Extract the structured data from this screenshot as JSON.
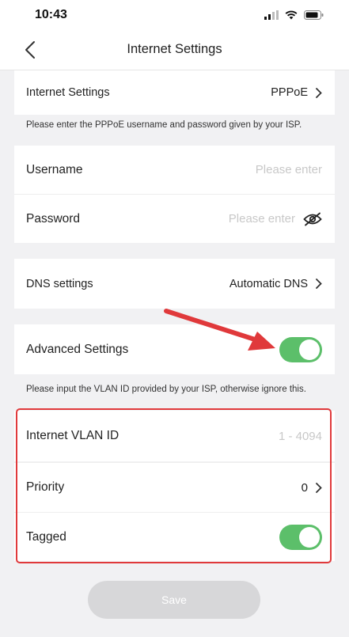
{
  "status_bar": {
    "time": "10:43"
  },
  "header": {
    "title": "Internet Settings"
  },
  "internet_settings": {
    "label": "Internet Settings",
    "value": "PPPoE"
  },
  "pppoe_note": "Please enter the PPPoE username and password given by your ISP.",
  "username": {
    "label": "Username",
    "placeholder": "Please enter"
  },
  "password": {
    "label": "Password",
    "placeholder": "Please enter"
  },
  "dns": {
    "label": "DNS settings",
    "value": "Automatic DNS"
  },
  "advanced": {
    "label": "Advanced Settings",
    "enabled": true
  },
  "vlan_note": "Please input the VLAN ID provided by your ISP, otherwise ignore this.",
  "vlan_id": {
    "label": "Internet VLAN ID",
    "placeholder": "1 - 4094"
  },
  "priority": {
    "label": "Priority",
    "value": "0"
  },
  "tagged": {
    "label": "Tagged",
    "enabled": true
  },
  "save_label": "Save",
  "colors": {
    "toggle_on": "#5cbf6a",
    "highlight": "#e0393b",
    "save_disabled": "#d7d7d9"
  }
}
